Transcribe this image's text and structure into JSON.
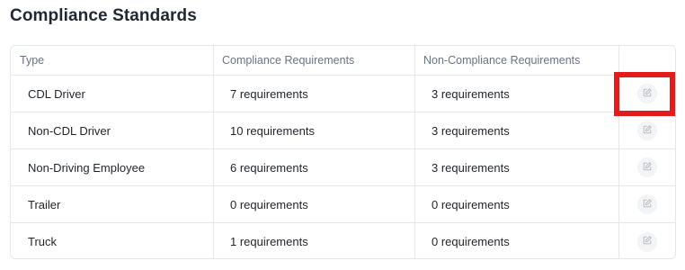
{
  "page": {
    "title": "Compliance Standards"
  },
  "table": {
    "headers": [
      "Type",
      "Compliance Requirements",
      "Non-Compliance Requirements",
      ""
    ],
    "rows": [
      {
        "type": "CDL Driver",
        "compliance": "7 requirements",
        "non_compliance": "3 requirements",
        "action_icon": "edit-icon"
      },
      {
        "type": "Non-CDL Driver",
        "compliance": "10 requirements",
        "non_compliance": "3 requirements",
        "action_icon": "edit-icon"
      },
      {
        "type": "Non-Driving Employee",
        "compliance": "6 requirements",
        "non_compliance": "3 requirements",
        "action_icon": "edit-icon"
      },
      {
        "type": "Trailer",
        "compliance": "0 requirements",
        "non_compliance": "0 requirements",
        "action_icon": "edit-icon"
      },
      {
        "type": "Truck",
        "compliance": "1 requirements",
        "non_compliance": "0 requirements",
        "action_icon": "edit-icon"
      }
    ]
  },
  "colors": {
    "border": "#e3e6ea",
    "header_text": "#6b7280",
    "highlight": "#e41b1b",
    "edit_button_bg": "#f3f4f6",
    "edit_icon": "#b8bdc4"
  }
}
